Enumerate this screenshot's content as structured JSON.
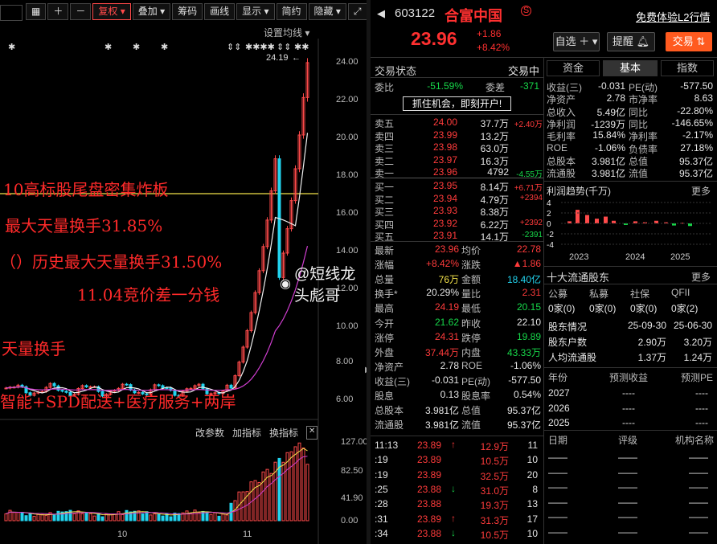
{
  "toolbar": {
    "items": [
      "复权",
      "叠加",
      "筹码",
      "画线",
      "显示",
      "简约",
      "隐藏"
    ],
    "settings": "设置均线"
  },
  "chart": {
    "price_labels": [
      "24.00",
      "22.00",
      "20.00",
      "18.00",
      "16.00",
      "14.00",
      "12.00",
      "10.00",
      "8.00",
      "6.00"
    ],
    "high_marker": "24.19",
    "annotations": [
      "10高标股尾盘密集炸板",
      "最大天量换手31.85%",
      "（）历史最大天量换手31.50%",
      "11.04竞价差一分钱",
      "天量换手",
      "智能+SPD配送+医疗服务+两岸"
    ],
    "watermark": "@短线龙头彪哥",
    "vol_tabs": [
      "改参数",
      "加指标",
      "换指标"
    ],
    "vol_labels": [
      "127.00",
      "82.50",
      "41.90",
      "0.00"
    ],
    "x_labels": [
      "10",
      "11"
    ]
  },
  "header": {
    "code": "603122",
    "name": "合富中国",
    "trial": "免费体验L2行情",
    "price": "23.96",
    "change": "+1.86",
    "pct": "+8.42%",
    "btn_watch": "自选",
    "btn_alert": "提醒",
    "btn_trade": "交易"
  },
  "status": {
    "label": "交易状态",
    "value": "交易中",
    "weibi_k": "委比",
    "weibi_v": "-51.59%",
    "weicha_k": "委差",
    "weicha_v": "-371",
    "promo": "抓住机会，即刻开户!"
  },
  "sells": [
    {
      "k": "卖五",
      "p": "24.00",
      "v": "37.7万",
      "d": "+2.40万"
    },
    {
      "k": "卖四",
      "p": "23.99",
      "v": "13.2万",
      "d": ""
    },
    {
      "k": "卖三",
      "p": "23.98",
      "v": "63.0万",
      "d": ""
    },
    {
      "k": "卖二",
      "p": "23.97",
      "v": "16.3万",
      "d": ""
    },
    {
      "k": "卖一",
      "p": "23.96",
      "v": "4792",
      "d": "-4.55万"
    }
  ],
  "buys": [
    {
      "k": "买一",
      "p": "23.95",
      "v": "8.14万",
      "d": "+6.71万"
    },
    {
      "k": "买二",
      "p": "23.94",
      "v": "4.79万",
      "d": "+2394"
    },
    {
      "k": "买三",
      "p": "23.93",
      "v": "8.38万",
      "d": ""
    },
    {
      "k": "买四",
      "p": "23.92",
      "v": "6.22万",
      "d": "+2392"
    },
    {
      "k": "买五",
      "p": "23.91",
      "v": "14.1万",
      "d": "-2391"
    }
  ],
  "stats": [
    {
      "k1": "最新",
      "v1": "23.96",
      "c1": "red",
      "k2": "均价",
      "v2": "22.78",
      "c2": "red"
    },
    {
      "k1": "涨幅",
      "v1": "+8.42%",
      "c1": "red",
      "k2": "涨跌",
      "v2": "▲1.86",
      "c2": "red"
    },
    {
      "k1": "总量",
      "v1": "76万",
      "c1": "yel",
      "k2": "金额",
      "v2": "18.40亿",
      "c2": "cyan"
    },
    {
      "k1": "换手*",
      "v1": "20.29%",
      "c1": "wht",
      "k2": "量比",
      "v2": "2.31",
      "c2": "red"
    },
    {
      "k1": "最高",
      "v1": "24.19",
      "c1": "red",
      "k2": "最低",
      "v2": "20.15",
      "c2": "grn"
    },
    {
      "k1": "今开",
      "v1": "21.62",
      "c1": "grn",
      "k2": "昨收",
      "v2": "22.10",
      "c2": "wht"
    },
    {
      "k1": "涨停",
      "v1": "24.31",
      "c1": "red",
      "k2": "跌停",
      "v2": "19.89",
      "c2": "grn"
    },
    {
      "k1": "外盘",
      "v1": "37.44万",
      "c1": "red",
      "k2": "内盘",
      "v2": "43.33万",
      "c2": "grn"
    },
    {
      "k1": "净资产",
      "v1": "2.78",
      "c1": "wht",
      "k2": "ROE",
      "v2": "-1.06%",
      "c2": "wht"
    },
    {
      "k1": "收益(三)",
      "v1": "-0.031",
      "c1": "wht",
      "k2": "PE(动)",
      "v2": "-577.50",
      "c2": "wht"
    },
    {
      "k1": "股息",
      "v1": "0.13",
      "c1": "wht",
      "k2": "股息率",
      "v2": "0.54%",
      "c2": "wht"
    },
    {
      "k1": "总股本",
      "v1": "3.981亿",
      "c1": "wht",
      "k2": "总值",
      "v2": "95.37亿",
      "c2": "wht"
    },
    {
      "k1": "流通股",
      "v1": "3.981亿",
      "c1": "wht",
      "k2": "流值",
      "v2": "95.37亿",
      "c2": "wht"
    }
  ],
  "ticks": [
    {
      "t": "11:13",
      "p": "23.89",
      "a": "up",
      "v": "12.9万",
      "n": "11"
    },
    {
      "t": ":19",
      "p": "23.89",
      "a": "",
      "v": "10.5万",
      "n": "10"
    },
    {
      "t": ":19",
      "p": "23.89",
      "a": "",
      "v": "32.5万",
      "n": "20"
    },
    {
      "t": ":25",
      "p": "23.88",
      "a": "down",
      "v": "31.0万",
      "n": "8"
    },
    {
      "t": ":28",
      "p": "23.88",
      "a": "",
      "v": "19.3万",
      "n": "13"
    },
    {
      "t": ":31",
      "p": "23.89",
      "a": "up",
      "v": "31.3万",
      "n": "17"
    },
    {
      "t": ":34",
      "p": "23.88",
      "a": "down",
      "v": "10.5万",
      "n": "10"
    }
  ],
  "fund_tabs": [
    "资金",
    "基本",
    "指数"
  ],
  "fund": [
    {
      "k1": "收益(三)",
      "v1": "-0.031",
      "k2": "PE(动)",
      "v2": "-577.50",
      "c2": ""
    },
    {
      "k1": "净资产",
      "v1": "2.78",
      "k2": "市净率",
      "v2": "8.63",
      "c2": ""
    },
    {
      "k1": "总收入",
      "v1": "5.49亿",
      "k2": "同比",
      "v2": "-22.80%",
      "c2": ""
    },
    {
      "k1": "净利润",
      "v1": "-1239万",
      "k2": "同比",
      "v2": "-146.65%",
      "c2": ""
    },
    {
      "k1": "毛利率",
      "v1": "15.84%",
      "k2": "净利率",
      "v2": "-2.17%",
      "c2": ""
    },
    {
      "k1": "ROE",
      "v1": "-1.06%",
      "k2": "负债率",
      "v2": "27.18%",
      "c2": ""
    },
    {
      "k1": "总股本",
      "v1": "3.981亿",
      "k2": "总值",
      "v2": "95.37亿",
      "c2": ""
    },
    {
      "k1": "流通股",
      "v1": "3.981亿",
      "k2": "流值",
      "v2": "95.37亿",
      "c2": ""
    }
  ],
  "profit": {
    "title": "利润趋势(千万)",
    "more": "更多",
    "yt": [
      "4",
      "2",
      "0",
      "-2",
      "-4"
    ],
    "years": [
      "2023",
      "2024",
      "2025"
    ]
  },
  "holders": {
    "title": "十大流通股东",
    "more": "更多",
    "types": [
      "公募",
      "私募",
      "社保",
      "QFII"
    ],
    "counts": [
      "0家(0)",
      "0家(0)",
      "0家(0)",
      "0家(2)"
    ],
    "rows": [
      {
        "k": "股东情况",
        "a": "25-09-30",
        "b": "25-06-30"
      },
      {
        "k": "股东户数",
        "a": "2.90万",
        "b": "3.20万"
      },
      {
        "k": "人均流通股",
        "a": "1.37万",
        "b": "1.24万"
      }
    ]
  },
  "forecast": {
    "h": [
      "年份",
      "预测收益",
      "预测PE"
    ],
    "rows": [
      [
        "2027",
        "----",
        "----"
      ],
      [
        "2026",
        "----",
        "----"
      ],
      [
        "2025",
        "----",
        "----"
      ]
    ]
  },
  "rating": {
    "h": [
      "日期",
      "评级",
      "机构名称"
    ],
    "rows": [
      [
        "——",
        "——",
        "——"
      ],
      [
        "——",
        "——",
        "——"
      ],
      [
        "——",
        "——",
        "——"
      ],
      [
        "——",
        "——",
        "——"
      ],
      [
        "——",
        "——",
        "——"
      ],
      [
        "——",
        "——",
        "——"
      ]
    ]
  }
}
